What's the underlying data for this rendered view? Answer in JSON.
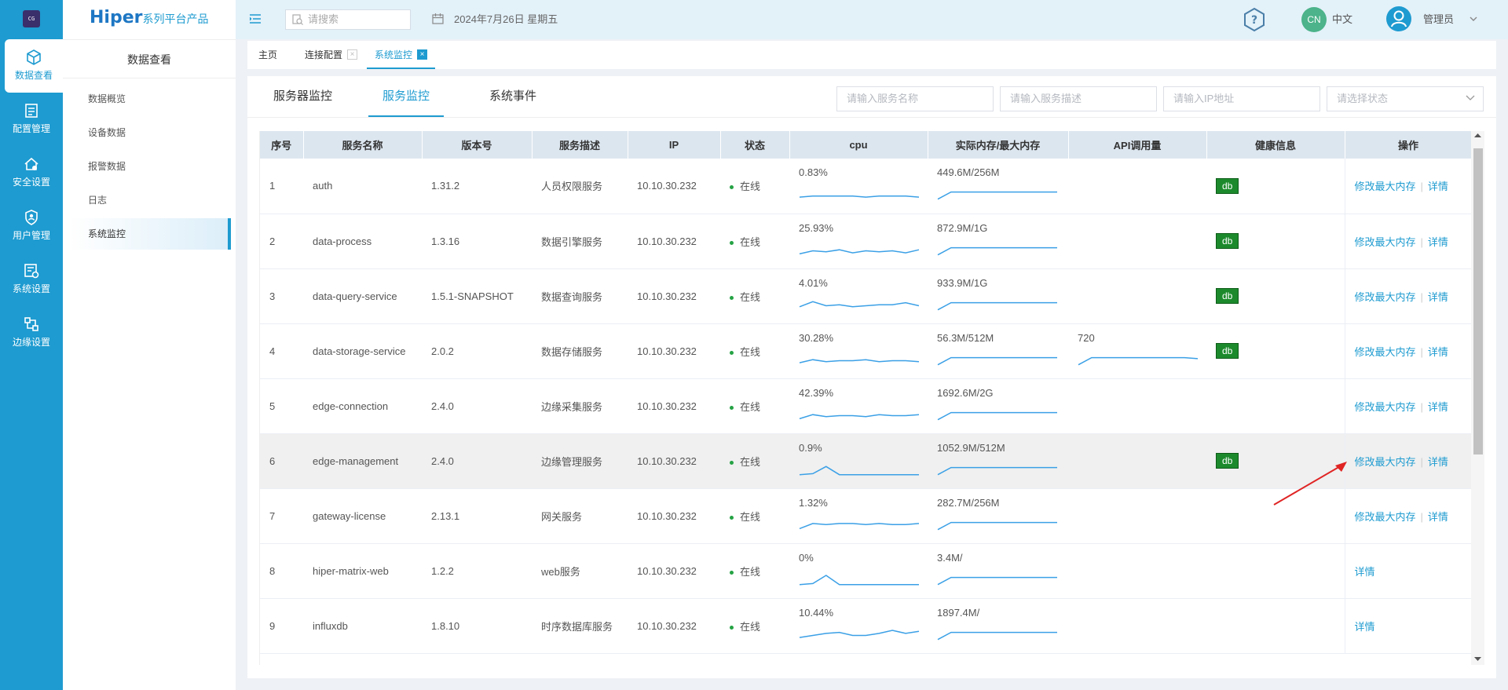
{
  "nav": {
    "items": [
      {
        "label": "数据查看",
        "icon": "cube-icon",
        "active": true
      },
      {
        "label": "配置管理",
        "icon": "config-icon"
      },
      {
        "label": "安全设置",
        "icon": "security-icon"
      },
      {
        "label": "用户管理",
        "icon": "user-shield-icon"
      },
      {
        "label": "系统设置",
        "icon": "system-settings-icon"
      },
      {
        "label": "边缘设置",
        "icon": "edge-icon"
      }
    ]
  },
  "brand": {
    "logo": "Hiper",
    "tagline": "系列平台产品",
    "app_icon_text": "CG"
  },
  "submenu": {
    "title": "数据查看",
    "items": [
      "数据概览",
      "设备数据",
      "报警数据",
      "日志",
      "系统监控"
    ],
    "active": "系统监控"
  },
  "topbar": {
    "search_placeholder": "请搜索",
    "date": "2024年7月26日 星期五",
    "lang_badge": "CN",
    "lang": "中文",
    "user": "管理员"
  },
  "tabs": [
    "主页",
    "连接配置",
    "系统监控"
  ],
  "panel": {
    "tabs": [
      "服务器监控",
      "服务监控",
      "系统事件"
    ],
    "active_tab": "服务监控",
    "filters": {
      "name": "请输入服务名称",
      "desc": "请输入服务描述",
      "ip": "请输入IP地址",
      "status": "请选择状态"
    }
  },
  "table": {
    "headers": [
      "序号",
      "服务名称",
      "版本号",
      "服务描述",
      "IP",
      "状态",
      "cpu",
      "实际内存/最大内存",
      "API调用量",
      "健康信息",
      "操作"
    ],
    "op_edit": "修改最大内存",
    "op_detail": "详情",
    "rows": [
      {
        "no": "1",
        "name": "auth",
        "version": "1.31.2",
        "desc": "人员权限服务",
        "ip": "10.10.30.232",
        "status": "在线",
        "cpu": "0.83%",
        "mem": "449.6M/256M",
        "api": "",
        "health": "db",
        "edit": true,
        "cpu_trend": [
          3,
          4,
          4,
          4,
          4,
          3,
          4,
          4,
          4,
          3
        ]
      },
      {
        "no": "2",
        "name": "data-process",
        "version": "1.3.16",
        "desc": "数据引擎服务",
        "ip": "10.10.30.232",
        "status": "在线",
        "cpu": "25.93%",
        "mem": "872.9M/1G",
        "api": "",
        "health": "db",
        "edit": true,
        "cpu_trend": [
          2,
          5,
          4,
          6,
          3,
          5,
          4,
          5,
          3,
          6
        ]
      },
      {
        "no": "3",
        "name": "data-query-service",
        "version": "1.5.1-SNAPSHOT",
        "desc": "数据查询服务",
        "ip": "10.10.30.232",
        "status": "在线",
        "cpu": "4.01%",
        "mem": "933.9M/1G",
        "api": "",
        "health": "db",
        "edit": true,
        "cpu_trend": [
          4,
          9,
          5,
          6,
          4,
          5,
          6,
          6,
          8,
          5
        ]
      },
      {
        "no": "4",
        "name": "data-storage-service",
        "version": "2.0.2",
        "desc": "数据存储服务",
        "ip": "10.10.30.232",
        "status": "在线",
        "cpu": "30.28%",
        "mem": "56.3M/512M",
        "api": "720",
        "health": "db",
        "edit": true,
        "cpu_trend": [
          3,
          6,
          4,
          5,
          5,
          6,
          4,
          5,
          5,
          4
        ]
      },
      {
        "no": "5",
        "name": "edge-connection",
        "version": "2.4.0",
        "desc": "边缘采集服务",
        "ip": "10.10.30.232",
        "status": "在线",
        "cpu": "42.39%",
        "mem": "1692.6M/2G",
        "api": "",
        "health": "",
        "edit": true,
        "cpu_trend": [
          2,
          6,
          4,
          5,
          5,
          4,
          6,
          5,
          5,
          6
        ]
      },
      {
        "no": "6",
        "name": "edge-management",
        "version": "2.4.0",
        "desc": "边缘管理服务",
        "ip": "10.10.30.232",
        "status": "在线",
        "cpu": "0.9%",
        "mem": "1052.9M/512M",
        "api": "",
        "health": "db",
        "edit": true,
        "cpu_trend": [
          1,
          2,
          9,
          1,
          1,
          1,
          1,
          1,
          1,
          1
        ]
      },
      {
        "no": "7",
        "name": "gateway-license",
        "version": "2.13.1",
        "desc": "网关服务",
        "ip": "10.10.30.232",
        "status": "在线",
        "cpu": "1.32%",
        "mem": "282.7M/256M",
        "api": "",
        "health": "",
        "edit": true,
        "cpu_trend": [
          2,
          7,
          6,
          7,
          7,
          6,
          7,
          6,
          6,
          7
        ]
      },
      {
        "no": "8",
        "name": "hiper-matrix-web",
        "version": "1.2.2",
        "desc": "web服务",
        "ip": "10.10.30.232",
        "status": "在线",
        "cpu": "0%",
        "mem": "3.4M/",
        "api": "",
        "health": "",
        "edit": false,
        "cpu_trend": [
          1,
          2,
          10,
          1,
          1,
          1,
          1,
          1,
          1,
          1
        ]
      },
      {
        "no": "9",
        "name": "influxdb",
        "version": "1.8.10",
        "desc": "时序数据库服务",
        "ip": "10.10.30.232",
        "status": "在线",
        "cpu": "10.44%",
        "mem": "1897.4M/",
        "api": "",
        "health": "",
        "edit": false,
        "cpu_trend": [
          3,
          5,
          7,
          8,
          5,
          5,
          7,
          10,
          7,
          9
        ]
      }
    ]
  }
}
